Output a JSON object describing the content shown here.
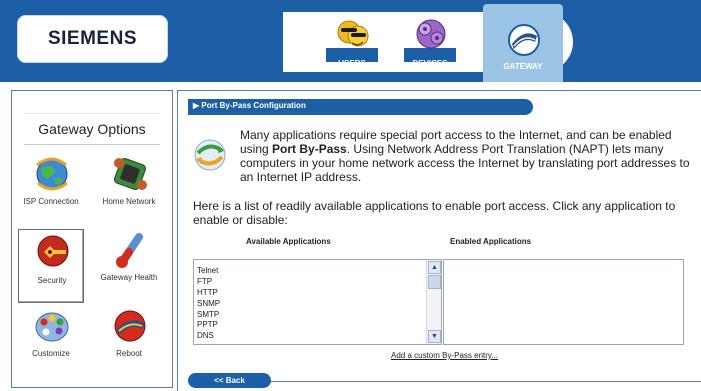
{
  "brand": {
    "logo_text": "SIEMENS"
  },
  "nav": {
    "items": [
      {
        "label": "USERS",
        "icon": "users-icon"
      },
      {
        "label": "DEVICES",
        "icon": "devices-icon"
      },
      {
        "label": "GATEWAY",
        "icon": "gateway-icon",
        "active": true
      }
    ]
  },
  "sidebar": {
    "title": "Gateway Options",
    "options": [
      {
        "label": "ISP Connection",
        "icon": "isp-connection-icon"
      },
      {
        "label": "Home Network",
        "icon": "home-network-icon"
      },
      {
        "label": "Security",
        "icon": "security-icon",
        "selected": true
      },
      {
        "label": "Gateway Health",
        "icon": "gateway-health-icon"
      },
      {
        "label": "Customize",
        "icon": "customize-icon"
      },
      {
        "label": "Reboot",
        "icon": "reboot-icon"
      }
    ]
  },
  "main": {
    "title": "Port By-Pass Configuration",
    "intro_before": "Many applications require special port access to the Internet, and can be enabled using ",
    "intro_bold": "Port By-Pass",
    "intro_after": ". Using Network Address Port Translation (NAPT) lets many computers in your home network access the Internet by translating port addresses to an Internet IP address.",
    "list_instructions": "Here is a list of readily available applications to enable port access. Click any application to enable or disable:",
    "available_header": "Available Applications",
    "enabled_header": "Enabled Applications",
    "available_apps": [
      "Telnet",
      "FTP",
      "HTTP",
      "SNMP",
      "SMTP",
      "PPTP",
      "DNS"
    ],
    "enabled_apps": [],
    "custom_link": "Add a custom By-Pass entry...",
    "back_label": "<< Back"
  },
  "colors": {
    "brand_blue": "#1d5fa6",
    "active_tab": "#9bc4e4",
    "panel_border": "#5a7da8"
  }
}
